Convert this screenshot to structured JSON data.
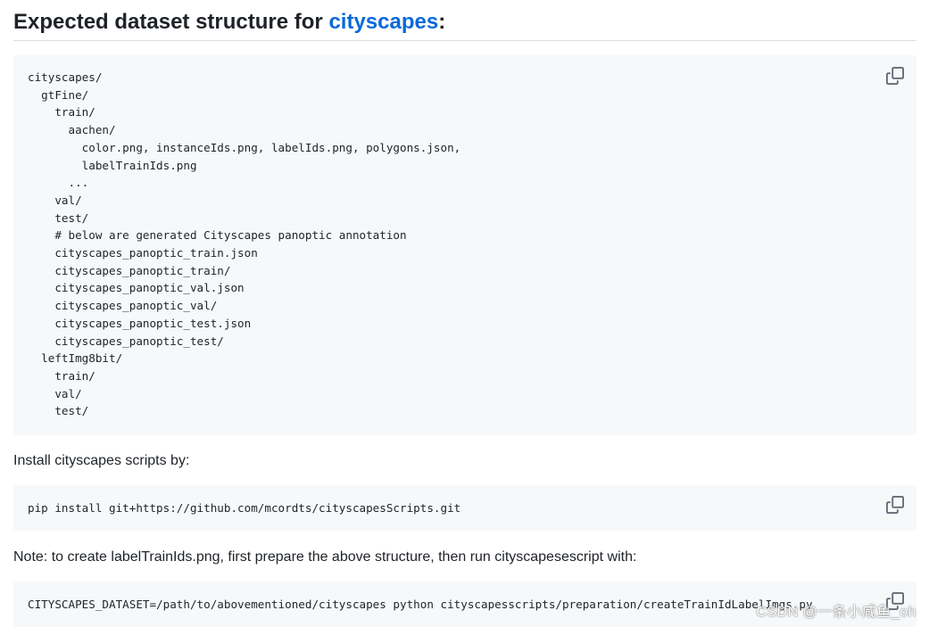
{
  "heading": {
    "prefix": "Expected dataset structure for ",
    "link_text": "cityscapes",
    "suffix": ":"
  },
  "tree_block": {
    "code": "cityscapes/\n  gtFine/\n    train/\n      aachen/\n        color.png, instanceIds.png, labelIds.png, polygons.json,\n        labelTrainIds.png\n      ...\n    val/\n    test/\n    # below are generated Cityscapes panoptic annotation\n    cityscapes_panoptic_train.json\n    cityscapes_panoptic_train/\n    cityscapes_panoptic_val.json\n    cityscapes_panoptic_val/\n    cityscapes_panoptic_test.json\n    cityscapes_panoptic_test/\n  leftImg8bit/\n    train/\n    val/\n    test/",
    "copy_icon": "copy-icon"
  },
  "install_paragraph": "Install cityscapes scripts by:",
  "pip_block": {
    "code": "pip install git+https://github.com/mcordts/cityscapesScripts.git",
    "copy_icon": "copy-icon"
  },
  "note_paragraph": "Note: to create labelTrainIds.png, first prepare the above structure, then run cityscapesescript with:",
  "env_block": {
    "code": "CITYSCAPES_DATASET=/path/to/abovementioned/cityscapes python cityscapesscripts/preparation/createTrainIdLabelImgs.py",
    "copy_icon": "copy-icon"
  },
  "watermark": "CSDN @一条小咸鱼_oh",
  "colors": {
    "link": "#0969da",
    "code_background": "#f6f8fa",
    "text": "#1f2328"
  }
}
